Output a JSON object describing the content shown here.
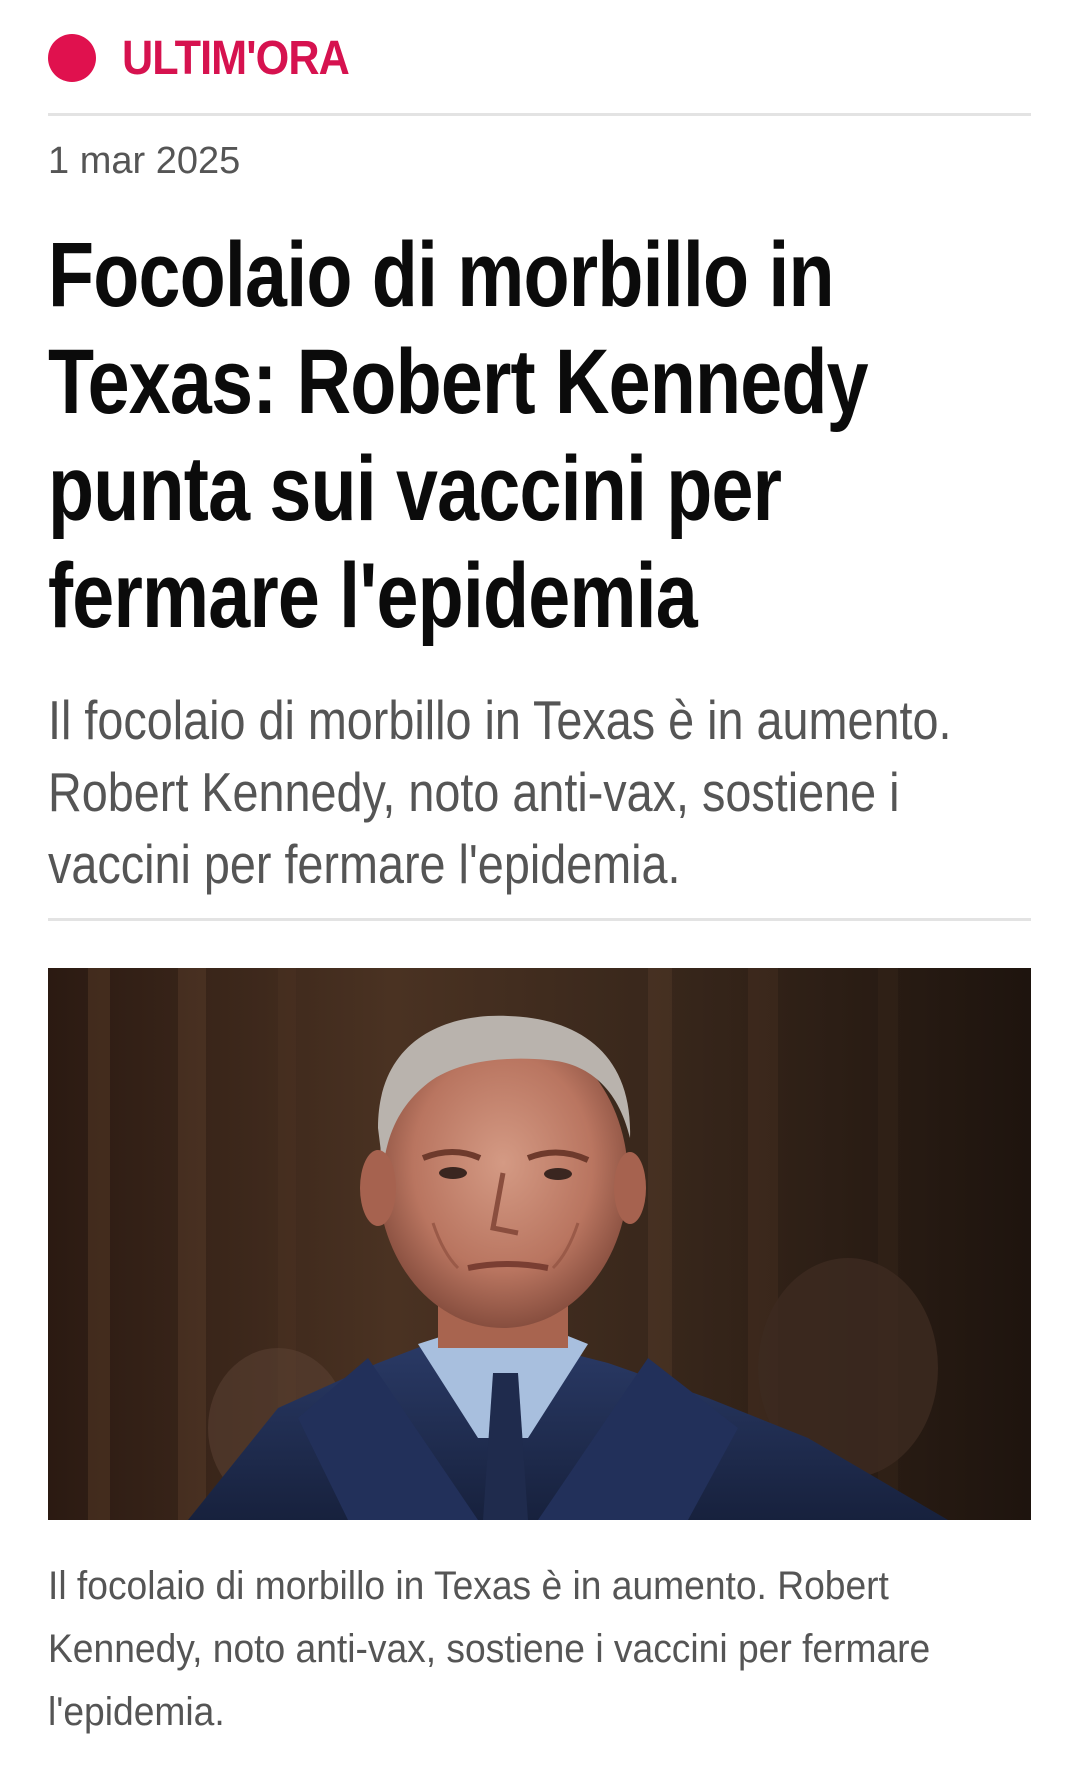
{
  "breaking": {
    "label": "ULTIM'ORA",
    "dot_color": "#e0114e",
    "label_color": "#d6124f"
  },
  "article": {
    "date": "1 mar 2025",
    "headline": "Focolaio di morbillo in Texas: Robert Kennedy punta sui vaccini per fermare l'epidemia",
    "summary": "Il focolaio di morbillo in Texas è in aumento. Robert Kennedy, noto anti-vax, sostiene i vaccini per fermare l'epidemia.",
    "caption": "Il focolaio di morbillo in Texas è in aumento. Robert Kennedy, noto anti-vax, sostiene i vaccini per fermare l'epidemia."
  }
}
